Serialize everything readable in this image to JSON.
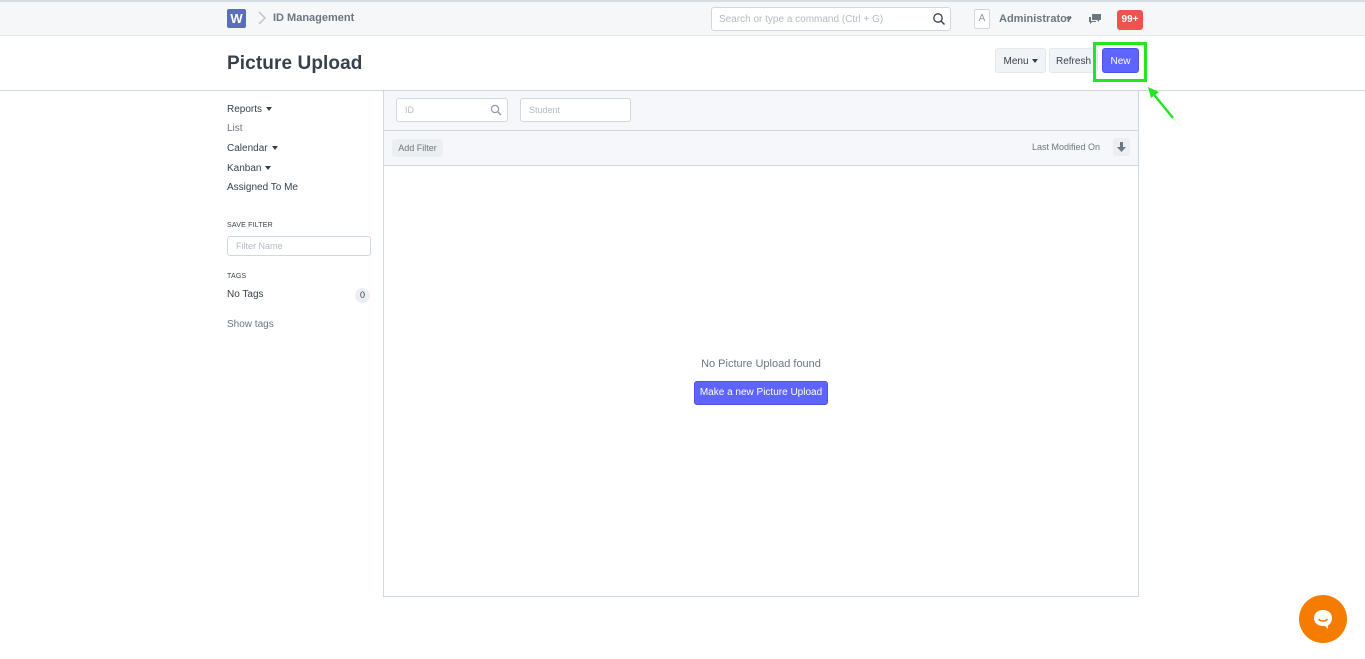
{
  "navbar": {
    "logo_letter": "W",
    "breadcrumb": "ID Management",
    "search_placeholder": "Search or type a command (Ctrl + G)",
    "avatar_letter": "A",
    "user_name": "Administrator",
    "notifications": "99+"
  },
  "page_head": {
    "title": "Picture Upload",
    "menu_label": "Menu",
    "refresh_label": "Refresh",
    "new_label": "New"
  },
  "sidebar": {
    "items": [
      {
        "label": "Reports",
        "has_caret": true
      },
      {
        "label": "List",
        "has_caret": false
      },
      {
        "label": "Calendar",
        "has_caret": true
      },
      {
        "label": "Kanban",
        "has_caret": true
      },
      {
        "label": "Assigned To Me",
        "has_caret": false
      }
    ],
    "save_filter_heading": "SAVE FILTER",
    "filter_name_placeholder": "Filter Name",
    "tags_heading": "TAGS",
    "no_tags_label": "No Tags",
    "no_tags_count": "0",
    "show_tags_label": "Show tags"
  },
  "list": {
    "id_placeholder": "ID",
    "student_placeholder": "Student",
    "add_filter_label": "Add Filter",
    "sort_label": "Last Modified On",
    "empty_message": "No Picture Upload found",
    "make_new_label": "Make a new Picture Upload"
  },
  "colors": {
    "primary": "#5e64ff",
    "highlight": "#22e622",
    "notification": "#ef5350",
    "chat": "#f57c00"
  }
}
